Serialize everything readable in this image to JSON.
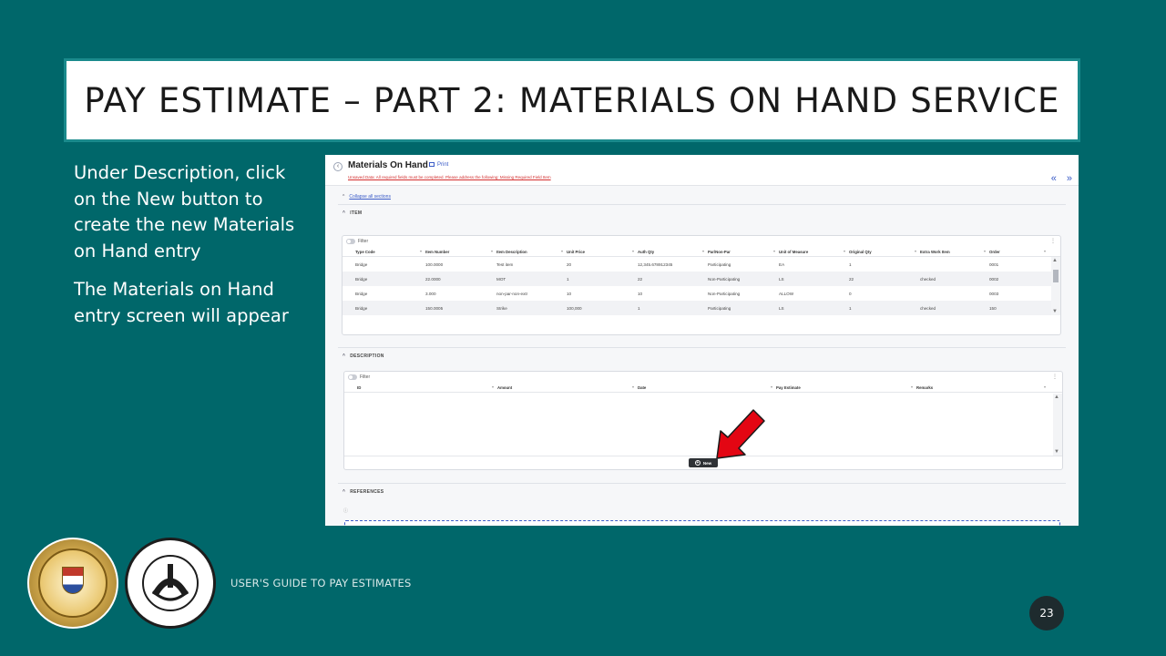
{
  "slide": {
    "title": "PAY ESTIMATE – PART 2: MATERIALS ON HAND SERVICE",
    "bullets": [
      "Under Description, click on the New button to create the new Materials on Hand entry",
      "The Materials on Hand entry screen will appear"
    ],
    "footer": "USER'S GUIDE TO PAY ESTIMATES",
    "page_number": "23"
  },
  "app": {
    "title": "Materials On Hand",
    "print_label": "Print",
    "warning": "Unsaved Data: All required fields must be completed. Please address the following: Missing Required Field Item",
    "collapse_all": "Collapse all sections",
    "sections": {
      "item": "ITEM",
      "description": "DESCRIPTION",
      "references": "REFERENCES"
    },
    "filter_label": "Filter",
    "item_grid": {
      "columns": [
        "Type Code",
        "Item Number",
        "Item Description",
        "Unit Price",
        "Auth Qty",
        "Par/Non-Par",
        "Unit of Measure",
        "Original Qty",
        "Extra Work Item",
        "Order"
      ],
      "rows": [
        [
          "Bridge",
          "100.0000",
          "Test item",
          "20",
          "12,345.678912345",
          "Participating",
          "EA",
          "1",
          "",
          "0001"
        ],
        [
          "Bridge",
          "22.0000",
          "MOT",
          "1",
          "22",
          "Non-Participating",
          "LS",
          "22",
          "checked",
          "0002"
        ],
        [
          "Bridge",
          "3.000",
          "non-par-non-extr",
          "10",
          "10",
          "Non-Participating",
          "ALLOW",
          "0",
          "",
          "0003"
        ],
        [
          "Bridge",
          "150.0005",
          "Strike",
          "100,000",
          "1",
          "Participating",
          "LS",
          "1",
          "checked",
          "150"
        ]
      ]
    },
    "description_grid": {
      "columns": [
        "ID",
        "Amount",
        "Date",
        "Pay Estimate",
        "Remarks"
      ]
    },
    "new_button": "New"
  },
  "colors": {
    "background": "#00676a",
    "title_border": "#1a8a8c",
    "callout_arrow": "#e30613",
    "link": "#3a5bc7"
  },
  "icons": {
    "back": "chevron-left-icon",
    "print": "printer-icon",
    "expand_panels": "double-chevron-right-icon",
    "section_toggle": "caret-up-icon",
    "new": "plus-circle-icon",
    "info": "info-icon",
    "menu": "kebab-menu-icon"
  }
}
